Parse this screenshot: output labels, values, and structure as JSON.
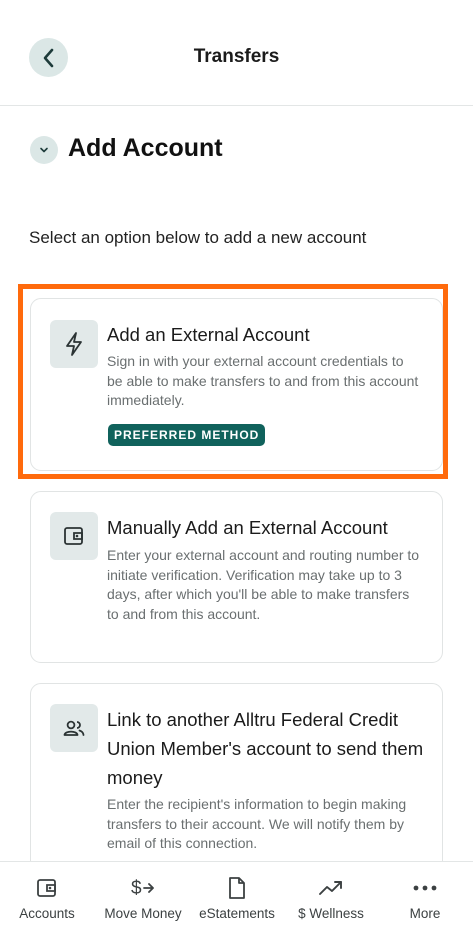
{
  "header": {
    "title": "Transfers"
  },
  "section": {
    "title": "Add Account"
  },
  "instructions": "Select an option below to add a new account",
  "options": [
    {
      "icon": "lightning-icon",
      "title": "Add an External Account",
      "description": "Sign in with your external account credentials to be able to make transfers to and from this account immediately.",
      "badge": "PREFERRED METHOD",
      "highlighted": true
    },
    {
      "icon": "wallet-icon",
      "title": "Manually Add an External Account",
      "description": "Enter your external account and routing number to initiate verification. Verification may take up to 3 days, after which you'll be able to make transfers to and from this account."
    },
    {
      "icon": "people-icon",
      "title": "Link to another Alltru Federal Credit Union Member's account to send them money",
      "description": "Enter the recipient's information to begin making transfers to their account. We will notify them by email of this connection."
    }
  ],
  "tabs": [
    {
      "label": "Accounts",
      "icon": "wallet-icon"
    },
    {
      "label": "Move Money",
      "icon": "dollar-transfer-icon"
    },
    {
      "label": "eStatements",
      "icon": "document-icon"
    },
    {
      "label": "$ Wellness",
      "icon": "trend-up-icon"
    },
    {
      "label": "More",
      "icon": "more-dots-icon"
    }
  ],
  "colors": {
    "accent": "#10625c",
    "highlight": "#ff6a0c",
    "icon_bg": "#dbe7e6"
  }
}
